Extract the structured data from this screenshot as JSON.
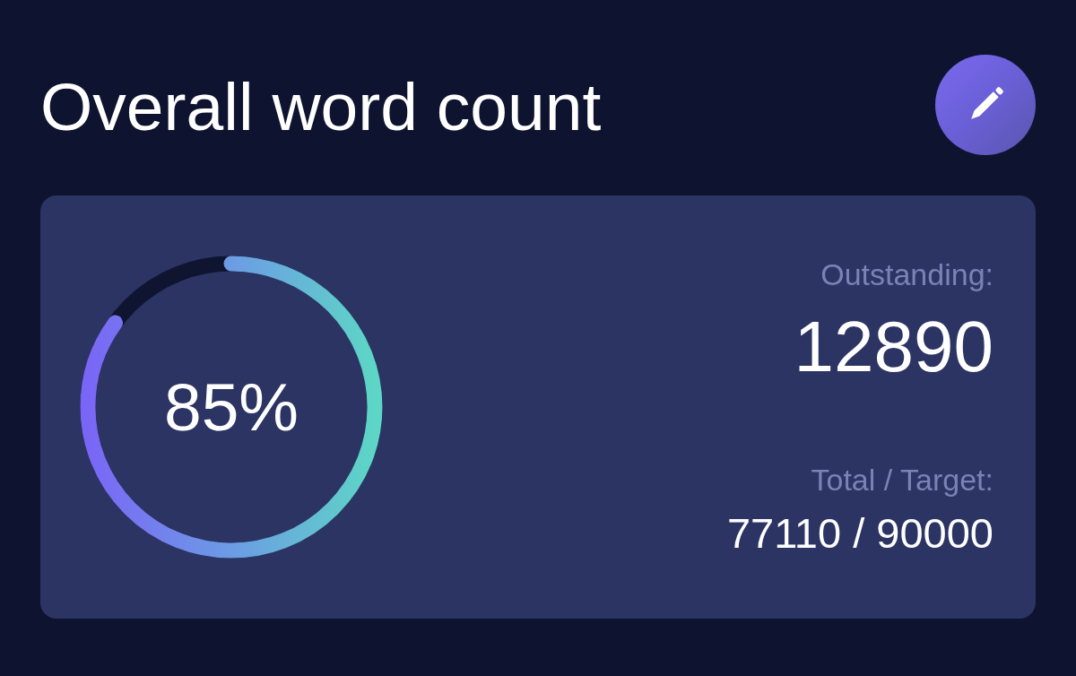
{
  "header": {
    "title": "Overall word count"
  },
  "progress": {
    "level": 0.85,
    "label": "85%"
  },
  "stats": [
    {
      "kind": "primary",
      "label": "Outstanding:",
      "value": "12890"
    },
    {
      "kind": "secondary",
      "label": "Total / Target:",
      "value": "77110 / 90000"
    }
  ]
}
